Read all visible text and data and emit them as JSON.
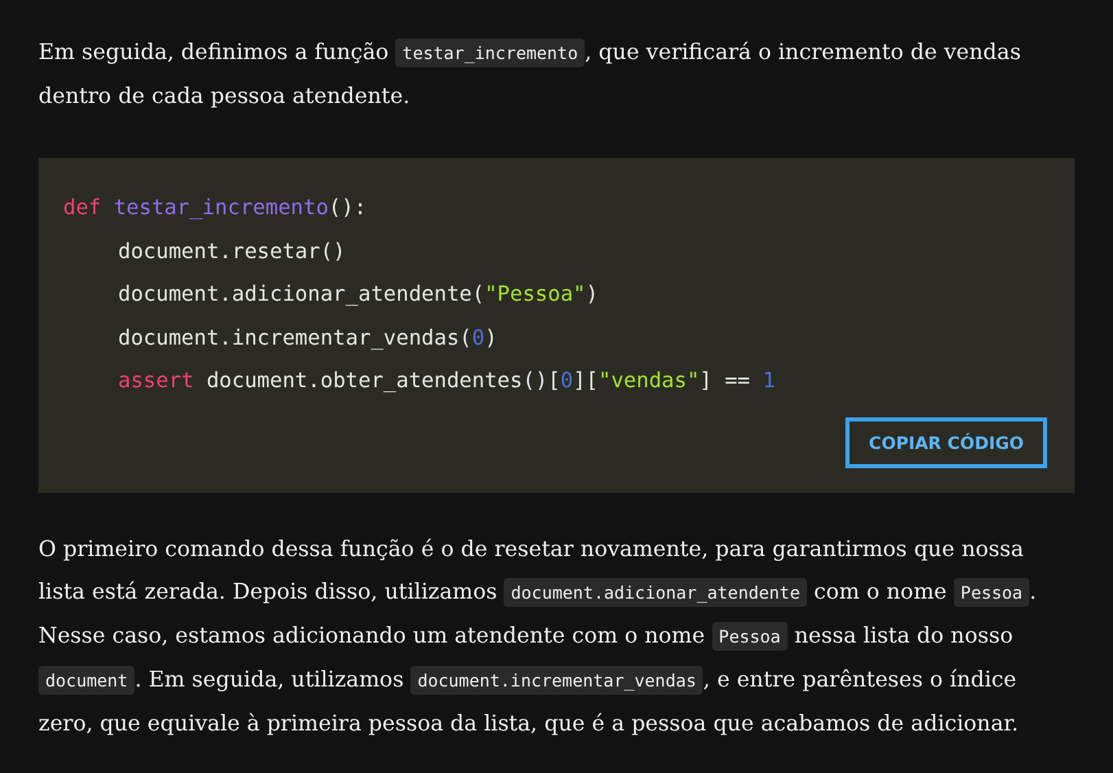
{
  "intro": [
    {
      "kind": "text",
      "text": "Em seguida, definimos a função "
    },
    {
      "kind": "code",
      "text": "testar_incremento"
    },
    {
      "kind": "text",
      "text": ", que verificará o incremento de vendas dentro de cada pessoa atendente."
    }
  ],
  "code_block": {
    "lines": [
      {
        "tokens": [
          {
            "kind": "keyword",
            "text": "def"
          },
          {
            "kind": "function",
            "text": "testar_incremento"
          },
          {
            "kind": "plain",
            "text": "():"
          }
        ],
        "children": [
          {
            "tokens": [
              {
                "kind": "plain",
                "text": "document.resetar()"
              }
            ]
          },
          {
            "tokens": [
              {
                "kind": "plain",
                "text": "document.adicionar_atendente("
              },
              {
                "kind": "string",
                "text": "\"Pessoa\""
              },
              {
                "kind": "plain",
                "text": ")"
              }
            ]
          },
          {
            "tokens": [
              {
                "kind": "plain",
                "text": "document.incrementar_vendas("
              },
              {
                "kind": "number",
                "text": "0"
              },
              {
                "kind": "plain",
                "text": ")"
              }
            ]
          },
          {
            "tokens": [
              {
                "kind": "keyword",
                "text": "assert"
              },
              {
                "kind": "plain",
                "text": "document.obter_atendentes()["
              },
              {
                "kind": "number",
                "text": "0"
              },
              {
                "kind": "plain",
                "text": "]["
              },
              {
                "kind": "string",
                "text": "\"vendas\""
              },
              {
                "kind": "plain",
                "text": "] == "
              },
              {
                "kind": "number",
                "text": "1"
              }
            ]
          }
        ]
      }
    ],
    "copy_button": "COPIAR CÓDIGO"
  },
  "body": [
    {
      "kind": "text",
      "text": "O primeiro comando dessa função é o de resetar novamente, para garantirmos que nossa lista está zerada. Depois disso, utilizamos "
    },
    {
      "kind": "code",
      "text": "document.adicionar_atendente"
    },
    {
      "kind": "text",
      "text": " com o nome "
    },
    {
      "kind": "code",
      "text": "Pessoa"
    },
    {
      "kind": "text",
      "text": ". Nesse caso, estamos adicionando um atendente com o nome "
    },
    {
      "kind": "code",
      "text": "Pessoa"
    },
    {
      "kind": "text",
      "text": " nessa lista do nosso "
    },
    {
      "kind": "code",
      "text": "document"
    },
    {
      "kind": "text",
      "text": ". Em seguida, utilizamos "
    },
    {
      "kind": "code",
      "text": "document.incrementar_vendas"
    },
    {
      "kind": "text",
      "text": ", e entre parênteses o índice zero, que equivale à primeira pessoa da lista, que é a pessoa que acabamos de adicionar."
    }
  ]
}
